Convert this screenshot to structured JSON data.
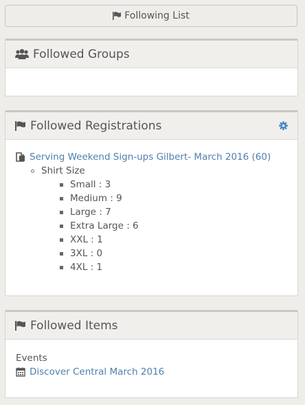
{
  "following_button": {
    "label": "Following List",
    "icon": "flag-icon"
  },
  "groups_panel": {
    "title": "Followed Groups",
    "icon": "users-icon"
  },
  "registrations_panel": {
    "title": "Followed Registrations",
    "icon": "flag-icon",
    "settings_icon": "gear-icon",
    "registration_link": "Serving Weekend Sign-ups Gilbert- March 2016 (60)",
    "question": "Shirt Size",
    "answers": [
      "Small : 3",
      "Medium : 9",
      "Large : 7",
      "Extra Large : 6",
      "XXL : 1",
      "3XL : 0",
      "4XL : 1"
    ]
  },
  "items_panel": {
    "title": "Followed Items",
    "icon": "flag-icon",
    "category": "Events",
    "event_link": "Discover Central March 2016",
    "event_icon": "calendar-icon"
  },
  "colors": {
    "link": "#4f7fae",
    "gear": "#4a85c4",
    "text": "#555555"
  }
}
